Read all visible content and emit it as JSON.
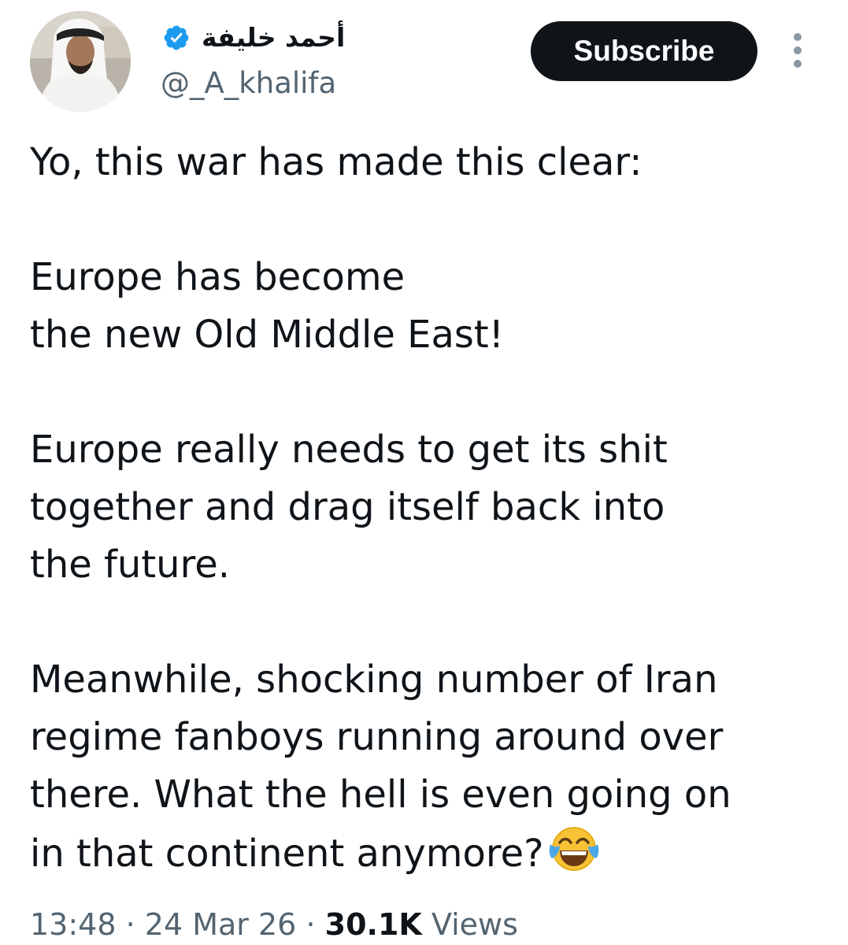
{
  "author": {
    "display_name": "أحمد خليفة",
    "handle": "@_A_khalifa",
    "verified": true,
    "verified_color": "#1d9bf0"
  },
  "actions": {
    "subscribe_label": "Subscribe",
    "more_icon": "more-vertical-icon"
  },
  "tweet": {
    "paragraphs": [
      [
        "Yo, this war has made this clear:"
      ],
      [
        "Europe has become",
        "the new Old Middle East!"
      ],
      [
        "Europe really needs to get its shit",
        "together and drag itself back into",
        "the future."
      ],
      [
        "Meanwhile, shocking number of Iran",
        "regime fanboys running around over",
        "there. What the hell is even going on",
        "in that continent anymore?"
      ]
    ],
    "trailing_emoji": "face-with-tears-of-joy-icon"
  },
  "meta": {
    "time": "13:48",
    "separator": "·",
    "date": "24 Mar 26",
    "views_count": "30.1K",
    "views_label": "Views"
  },
  "colors": {
    "text_primary": "#0f1419",
    "text_secondary": "#536471",
    "button_bg": "#0f1419",
    "button_text": "#ffffff"
  }
}
